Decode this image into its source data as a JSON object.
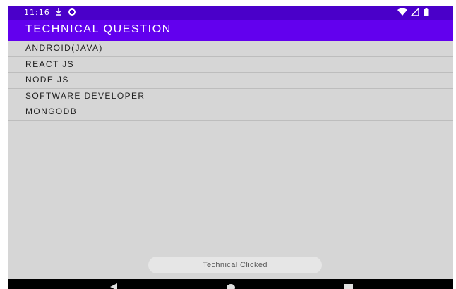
{
  "status_bar": {
    "time": "11:16",
    "icons_left": [
      "download-icon",
      "data-saver-icon"
    ],
    "icons_right": [
      "wifi-icon",
      "signal-icon",
      "battery-icon"
    ],
    "background": "#4a00c9"
  },
  "app_bar": {
    "title": "TECHNICAL QUESTION",
    "background": "#6200ee"
  },
  "list": {
    "items": [
      {
        "label": "ANDROID(JAVA)"
      },
      {
        "label": "REACT JS"
      },
      {
        "label": "NODE JS"
      },
      {
        "label": "SOFTWARE DEVELOPER"
      },
      {
        "label": "MONGODB"
      }
    ]
  },
  "toast": {
    "message": "Technical Clicked"
  },
  "nav_bar": {
    "buttons": [
      "back-icon",
      "home-icon",
      "recents-icon"
    ]
  }
}
